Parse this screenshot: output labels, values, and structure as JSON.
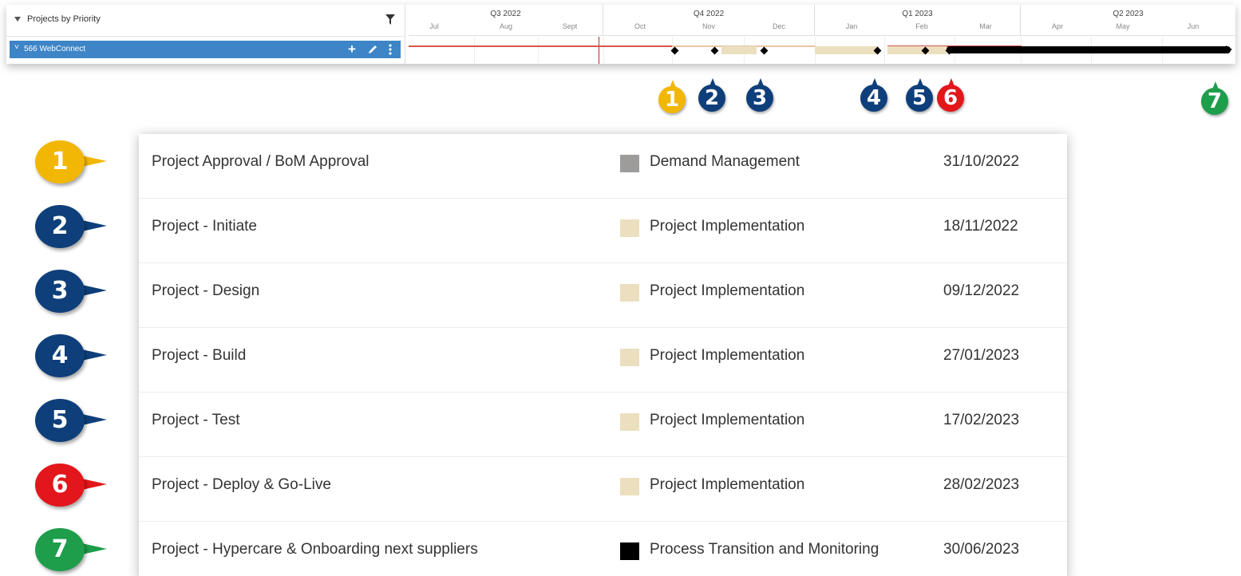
{
  "panel": {
    "title": "Projects by Priority",
    "project_label": "566 WebConnect",
    "chevron": "˅",
    "add_glyph": "+"
  },
  "timeline": {
    "quarters": [
      {
        "label": "Q3 2022",
        "months": [
          "Jul",
          "Aug",
          "Sept"
        ]
      },
      {
        "label": "Q4 2022",
        "months": [
          "Oct",
          "Nov",
          "Dec"
        ]
      },
      {
        "label": "Q1 2023",
        "months": [
          "Jan",
          "Feb",
          "Mar"
        ]
      },
      {
        "label": "Q2 2023",
        "months": [
          "Apr",
          "May",
          "Jun"
        ]
      }
    ]
  },
  "markers": [
    "1",
    "2",
    "3",
    "4",
    "5",
    "6",
    "7"
  ],
  "milestones": [
    {
      "num": "1",
      "name": "Project Approval / BoM Approval",
      "category": "Demand Management",
      "date": "31/10/2022",
      "swatch": "#9e9b9b",
      "badge_color": "#f2b705"
    },
    {
      "num": "2",
      "name": "Project - Initiate",
      "category": "Project Implementation",
      "date": "18/11/2022",
      "swatch": "#ecdfbf",
      "badge_color": "#0e3f7a"
    },
    {
      "num": "3",
      "name": "Project - Design",
      "category": "Project Implementation",
      "date": "09/12/2022",
      "swatch": "#ecdfbf",
      "badge_color": "#0e3f7a"
    },
    {
      "num": "4",
      "name": "Project - Build",
      "category": "Project Implementation",
      "date": "27/01/2023",
      "swatch": "#ecdfbf",
      "badge_color": "#0e3f7a"
    },
    {
      "num": "5",
      "name": "Project - Test",
      "category": "Project Implementation",
      "date": "17/02/2023",
      "swatch": "#ecdfbf",
      "badge_color": "#0e3f7a"
    },
    {
      "num": "6",
      "name": "Project - Deploy & Go-Live",
      "category": "Project Implementation",
      "date": "28/02/2023",
      "swatch": "#ecdfbf",
      "badge_color": "#e3161b"
    },
    {
      "num": "7",
      "name": "Project - Hypercare & Onboarding next suppliers",
      "category": "Process Transition and Monitoring",
      "date": "30/06/2023",
      "swatch": "#000000",
      "badge_color": "#1e9d4b"
    }
  ],
  "colors": {
    "accent_blue": "#3d85c6",
    "gold": "#f2b705",
    "navy": "#0e3f7a",
    "red": "#e3161b",
    "green": "#1e9d4b",
    "red_line": "#d9534f"
  }
}
